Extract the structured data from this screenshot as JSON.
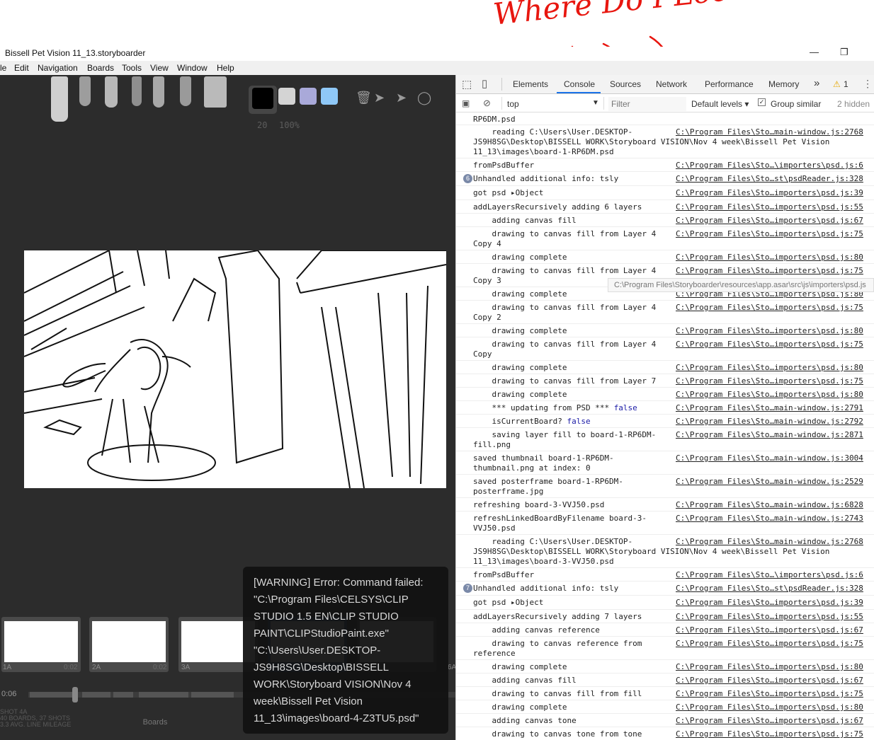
{
  "annotation": {
    "text": "Where Do I Look"
  },
  "window": {
    "title": "Bissell Pet Vision 11_13.storyboarder",
    "minimize": "—",
    "maximize": "❐"
  },
  "menu": [
    "le",
    "Edit",
    "Navigation",
    "Boards",
    "Tools",
    "View",
    "Window",
    "Help"
  ],
  "toolbar": {
    "brush_size": "20",
    "opacity": "100%",
    "swatch_colors": [
      "#000000",
      "#d4d4d4",
      "#a9a9d9",
      "#8fc8f7"
    ]
  },
  "thumbnails": [
    {
      "label": "1A",
      "time": "0:02"
    },
    {
      "label": "2A",
      "time": "0:02"
    },
    {
      "label": "3A",
      "time": ""
    },
    {
      "label": "",
      "time": ""
    },
    {
      "label": "",
      "time": ""
    },
    {
      "label": "6A",
      "time": ""
    }
  ],
  "timeline": {
    "time": "0:06",
    "progress": 0.11
  },
  "stats": {
    "shot": "SHOT 4A",
    "boards": "40 BOARDS, 37 SHOTS",
    "mileage": "3.3 AVG. LINE MILEAGE"
  },
  "boards_button": "Boards",
  "tooltip": "[WARNING] Error: Command failed: \"C:\\Program Files\\CELSYS\\CLIP STUDIO 1.5 EN\\CLIP STUDIO PAINT\\CLIPStudioPaint.exe\" \"C:\\Users\\User.DESKTOP-JS9H8SG\\Desktop\\BISSELL WORK\\Storyboard VISION\\Nov 4 week\\Bissell Pet Vision 11_13\\images\\board-4-Z3TU5.psd\"",
  "devtools": {
    "tabs": [
      "Elements",
      "Console",
      "Sources",
      "Network",
      "Performance",
      "Memory"
    ],
    "more": "»",
    "warning_count": "1",
    "context": "top",
    "filter_placeholder": "Filter",
    "levels": "Default levels ▾",
    "group_similar": "Group similar",
    "hidden": "2 hidden",
    "path_tooltip": "C:\\Program Files\\Storyboarder\\resources\\app.asar\\src\\js\\importers\\psd.js"
  },
  "console": [
    {
      "msg": "RP6DM.psd",
      "src": "",
      "h": 18
    },
    {
      "msg": "    reading C:\\Users\\User.DESKTOP-\nJS9H8SG\\Desktop\\BISSELL WORK\\Storyboard VISION\\Nov 4 week\\Bissell Pet Vision\n11_13\\images\\board-1-RP6DM.psd",
      "src": "C:\\Program Files\\Sto…main-window.js:2768",
      "h": 47,
      "full": true
    },
    {
      "msg": "fromPsdBuffer",
      "src": "C:\\Program Files\\Sto…\\importers\\psd.js:6",
      "h": 19
    },
    {
      "msg": "Unhandled additional info: tsly",
      "src": "C:\\Program Files\\Sto…st\\psdReader.js:328",
      "h": 20,
      "badge": "6"
    },
    {
      "msg": "got psd ▸Object",
      "src": "C:\\Program Files\\Sto…importers\\psd.js:39",
      "h": 20
    },
    {
      "msg": "addLayersRecursively adding 6 layers",
      "src": "C:\\Program Files\\Sto…importers\\psd.js:55",
      "h": 19
    },
    {
      "msg": "    adding canvas fill",
      "src": "C:\\Program Files\\Sto…importers\\psd.js:67",
      "h": 19
    },
    {
      "msg": "    drawing to canvas fill from Layer 4\nCopy 4",
      "src": "C:\\Program Files\\Sto…importers\\psd.js:75",
      "h": 33
    },
    {
      "msg": "    drawing complete",
      "src": "C:\\Program Files\\Sto…importers\\psd.js:80",
      "h": 19
    },
    {
      "msg": "    drawing to canvas fill from Layer 4\nCopy 3",
      "src": "C:\\Program Files\\Sto…importers\\psd.js:75",
      "h": 33
    },
    {
      "msg": "    drawing complete",
      "src": "C:\\Program Files\\Sto…importers\\psd.js:80",
      "h": 19
    },
    {
      "msg": "    drawing to canvas fill from Layer 4\nCopy 2",
      "src": "C:\\Program Files\\Sto…importers\\psd.js:75",
      "h": 33
    },
    {
      "msg": "    drawing complete",
      "src": "C:\\Program Files\\Sto…importers\\psd.js:80",
      "h": 19
    },
    {
      "msg": "    drawing to canvas fill from Layer 4\nCopy",
      "src": "C:\\Program Files\\Sto…importers\\psd.js:75",
      "h": 33
    },
    {
      "msg": "    drawing complete",
      "src": "C:\\Program Files\\Sto…importers\\psd.js:80",
      "h": 19
    },
    {
      "msg": "    drawing to canvas fill from Layer 7",
      "src": "C:\\Program Files\\Sto…importers\\psd.js:75",
      "h": 19
    },
    {
      "msg": "    drawing complete",
      "src": "C:\\Program Files\\Sto…importers\\psd.js:80",
      "h": 19
    },
    {
      "msg": "    *** updating from PSD *** false",
      "src": "C:\\Program Files\\Sto…main-window.js:2791",
      "h": 19,
      "kw": "false"
    },
    {
      "msg": "    isCurrentBoard? false",
      "src": "C:\\Program Files\\Sto…main-window.js:2792",
      "h": 19,
      "kw": "false"
    },
    {
      "msg": "    saving layer fill to board-1-RP6DM-\nfill.png",
      "src": "C:\\Program Files\\Sto…main-window.js:2871",
      "h": 33
    },
    {
      "msg": "saved thumbnail board-1-RP6DM-\nthumbnail.png at index: 0",
      "src": "C:\\Program Files\\Sto…main-window.js:3004",
      "h": 33
    },
    {
      "msg": "saved posterframe board-1-RP6DM-\nposterframe.jpg",
      "src": "C:\\Program Files\\Sto…main-window.js:2529",
      "h": 33
    },
    {
      "msg": "refreshing board-3-VVJ50.psd",
      "src": "C:\\Program Files\\Sto…main-window.js:6828",
      "h": 19
    },
    {
      "msg": "refreshLinkedBoardByFilename board-3-\nVVJ50.psd",
      "src": "C:\\Program Files\\Sto…main-window.js:2743",
      "h": 33
    },
    {
      "msg": "    reading C:\\Users\\User.DESKTOP-\nJS9H8SG\\Desktop\\BISSELL WORK\\Storyboard VISION\\Nov 4 week\\Bissell Pet Vision\n11_13\\images\\board-3-VVJ50.psd",
      "src": "C:\\Program Files\\Sto…main-window.js:2768",
      "h": 47,
      "full": true
    },
    {
      "msg": "fromPsdBuffer",
      "src": "C:\\Program Files\\Sto…\\importers\\psd.js:6",
      "h": 19
    },
    {
      "msg": "Unhandled additional info: tsly",
      "src": "C:\\Program Files\\Sto…st\\psdReader.js:328",
      "h": 20,
      "badge": "7"
    },
    {
      "msg": "got psd ▸Object",
      "src": "C:\\Program Files\\Sto…importers\\psd.js:39",
      "h": 20
    },
    {
      "msg": "addLayersRecursively adding 7 layers",
      "src": "C:\\Program Files\\Sto…importers\\psd.js:55",
      "h": 19
    },
    {
      "msg": "    adding canvas reference",
      "src": "C:\\Program Files\\Sto…importers\\psd.js:67",
      "h": 19
    },
    {
      "msg": "    drawing to canvas reference from\nreference",
      "src": "C:\\Program Files\\Sto…importers\\psd.js:75",
      "h": 33
    },
    {
      "msg": "    drawing complete",
      "src": "C:\\Program Files\\Sto…importers\\psd.js:80",
      "h": 19
    },
    {
      "msg": "    adding canvas fill",
      "src": "C:\\Program Files\\Sto…importers\\psd.js:67",
      "h": 19
    },
    {
      "msg": "    drawing to canvas fill from fill",
      "src": "C:\\Program Files\\Sto…importers\\psd.js:75",
      "h": 19
    },
    {
      "msg": "    drawing complete",
      "src": "C:\\Program Files\\Sto…importers\\psd.js:80",
      "h": 19
    },
    {
      "msg": "    adding canvas tone",
      "src": "C:\\Program Files\\Sto…importers\\psd.js:67",
      "h": 19
    },
    {
      "msg": "    drawing to canvas tone from tone",
      "src": "C:\\Program Files\\Sto…importers\\psd.js:75",
      "h": 19
    }
  ]
}
